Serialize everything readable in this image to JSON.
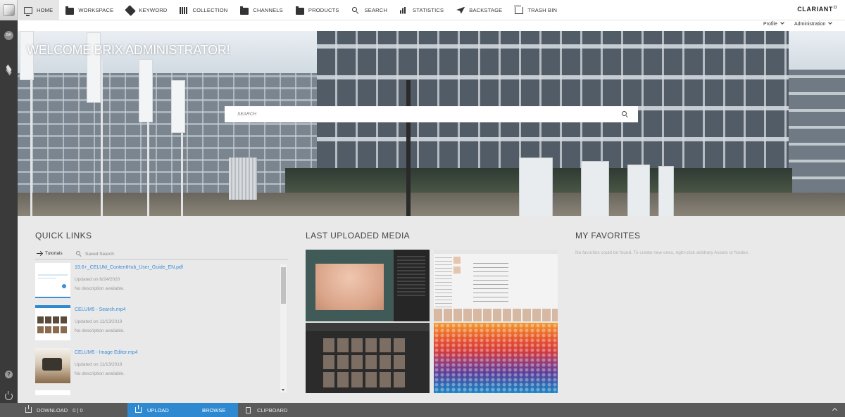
{
  "brand": "CLARIANT",
  "nav": [
    {
      "label": "HOME",
      "icon": "monitor-icon",
      "active": true
    },
    {
      "label": "WORKSPACE",
      "icon": "folder-icon"
    },
    {
      "label": "KEYWORD",
      "icon": "tag-icon"
    },
    {
      "label": "COLLECTION",
      "icon": "books-icon"
    },
    {
      "label": "CHANNELS",
      "icon": "folder-icon"
    },
    {
      "label": "PRODUCTS",
      "icon": "folder-icon"
    },
    {
      "label": "SEARCH",
      "icon": "search-icon"
    },
    {
      "label": "STATISTICS",
      "icon": "bar-chart-icon"
    },
    {
      "label": "BACKSTAGE",
      "icon": "plane-icon"
    },
    {
      "label": "TRASH BIN",
      "icon": "trash-icon"
    }
  ],
  "subbar": {
    "profile": "Profile",
    "administration": "Administration"
  },
  "sidebar": {
    "avatar": "BA"
  },
  "hero": {
    "welcome": "WELCOME BRIX ADMINISTRATOR!",
    "search_placeholder": "SEARCH"
  },
  "sections": {
    "quick_links": "QUICK LINKS",
    "last_uploaded": "LAST UPLOADED MEDIA",
    "favorites": "MY FAVORITES"
  },
  "quick_links": {
    "tabs": {
      "tutorials": "Tutorials",
      "saved_search": "Saved Search"
    },
    "items": [
      {
        "name": "19.6+_CELUM_ContentHub_User_Guide_EN.pdf",
        "updated": "Updated on 6/24/2020",
        "description": "No description available."
      },
      {
        "name": "CELUM5 - Search.mp4",
        "updated": "Updated on 11/13/2019",
        "description": "No description available."
      },
      {
        "name": "CELUM5 - Image Editor.mp4",
        "updated": "Updated on 11/13/2019",
        "description": "No description available."
      }
    ]
  },
  "favorites": {
    "empty_text": "No favorites could be found. To create new ones, right-click arbitrary Assets or Nodes."
  },
  "bottombar": {
    "download": "DOWNLOAD",
    "download_count": "0 | 0",
    "upload": "UPLOAD",
    "browse": "BROWSE",
    "clipboard": "CLIPBOARD"
  },
  "colors": {
    "accent": "#2f89d0",
    "link": "#3c8ed6",
    "sidebar": "#3a3a3a",
    "bottombar": "#5a5a5a"
  }
}
